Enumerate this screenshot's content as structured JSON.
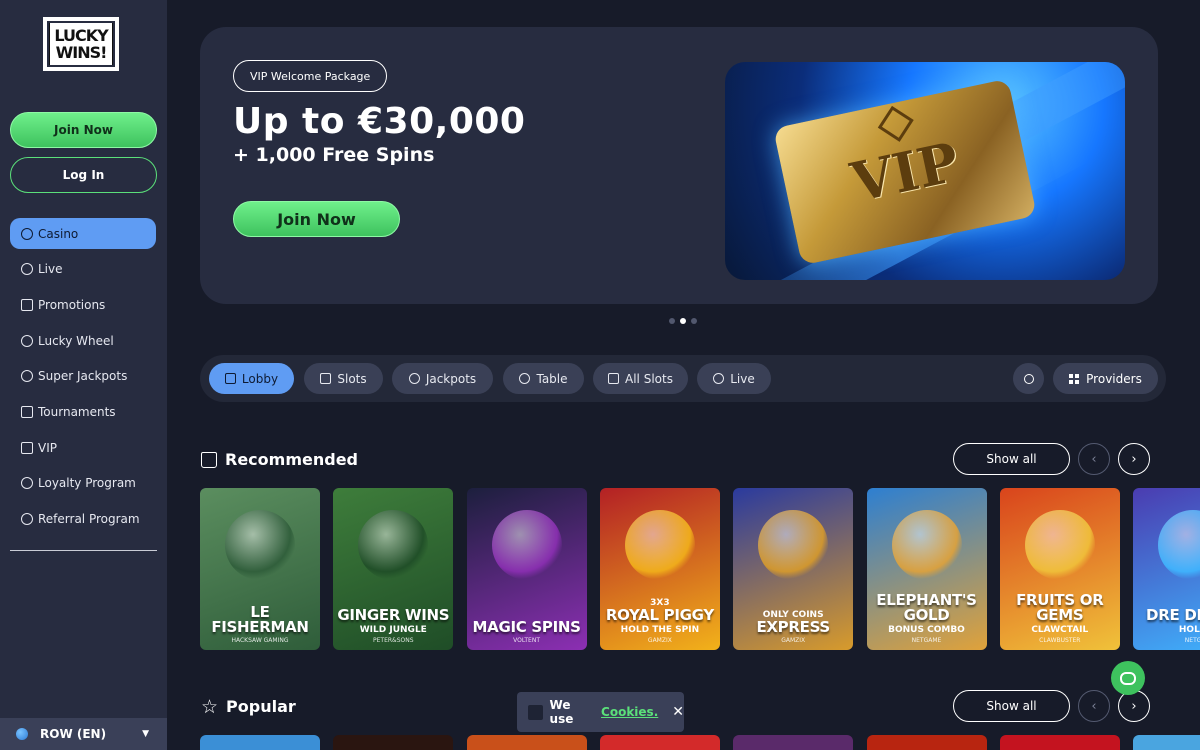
{
  "brand": {
    "logo_line1": "LUCKY",
    "logo_line2": "WINS!"
  },
  "sidebar": {
    "join_label": "Join Now",
    "login_label": "Log In",
    "items": [
      {
        "label": "Casino",
        "icon": "casino-icon",
        "active": true
      },
      {
        "label": "Live",
        "icon": "live-icon"
      },
      {
        "label": "Promotions",
        "icon": "gift-icon"
      },
      {
        "label": "Lucky Wheel",
        "icon": "wheel-icon"
      },
      {
        "label": "Super Jackpots",
        "icon": "jackpot-icon"
      },
      {
        "label": "Tournaments",
        "icon": "trophy-icon"
      },
      {
        "label": "VIP",
        "icon": "crown-icon"
      },
      {
        "label": "Loyalty Program",
        "icon": "loyalty-icon"
      },
      {
        "label": "Referral Program",
        "icon": "referral-icon"
      }
    ],
    "language": "ROW (EN)"
  },
  "hero": {
    "badge": "VIP Welcome Package",
    "title": "Up to €30,000",
    "subtitle": "+ 1,000 Free Spins",
    "cta": "Join Now",
    "art_text": "VIP"
  },
  "tabs": [
    {
      "label": "Lobby",
      "active": true
    },
    {
      "label": "Slots"
    },
    {
      "label": "Jackpots"
    },
    {
      "label": "Table"
    },
    {
      "label": "All Slots"
    },
    {
      "label": "Live"
    }
  ],
  "providers_label": "Providers",
  "sections": {
    "recommended": {
      "title": "Recommended",
      "show_all": "Show all",
      "games": [
        {
          "pre": "",
          "title": "LE FISHERMAN",
          "sub": "",
          "provider": "HACKSAW GAMING",
          "bg": "#5b8e5f",
          "accent": "#2f5d3a"
        },
        {
          "pre": "",
          "title": "GINGER WINS",
          "sub": "WILD JUNGLE",
          "provider": "PETER&SONS",
          "bg": "#3e7d3b",
          "accent": "#1f4d27"
        },
        {
          "pre": "",
          "title": "MAGIC SPINS",
          "sub": "",
          "provider": "VOLTENT",
          "bg": "#1c1f3d",
          "accent": "#8c2fb3"
        },
        {
          "pre": "3X3",
          "title": "ROYAL PIGGY",
          "sub": "HOLD THE SPIN",
          "provider": "GAMZIX",
          "bg": "#b32025",
          "accent": "#f2b21a"
        },
        {
          "pre": "ONLY COINS",
          "title": "EXPRESS",
          "sub": "",
          "provider": "GAMZIX",
          "bg": "#2a3a9e",
          "accent": "#d89b2b"
        },
        {
          "pre": "",
          "title": "ELEPHANT'S GOLD",
          "sub": "BONUS COMBO",
          "provider": "NETGAME",
          "bg": "#2d7fd1",
          "accent": "#e0a23a"
        },
        {
          "pre": "",
          "title": "FRUITS OR GEMS",
          "sub": "CLAWCTAIL",
          "provider": "CLAWBUSTER",
          "bg": "#d9441c",
          "accent": "#f0c23a"
        },
        {
          "pre": "",
          "title": "DRE DIAMO",
          "sub": "HOLD",
          "provider": "NETG",
          "bg": "#4a3cb0",
          "accent": "#3fb6ff"
        }
      ]
    },
    "popular": {
      "title": "Popular",
      "show_all": "Show all",
      "strip_colors": [
        "#3b8fd6",
        "#2a1510",
        "#c9501a",
        "#d32a2a",
        "#5a2a6a",
        "#b82510",
        "#c4131f",
        "#4aa5e0"
      ]
    }
  },
  "cookie": {
    "text": "We use",
    "link": "Cookies."
  }
}
